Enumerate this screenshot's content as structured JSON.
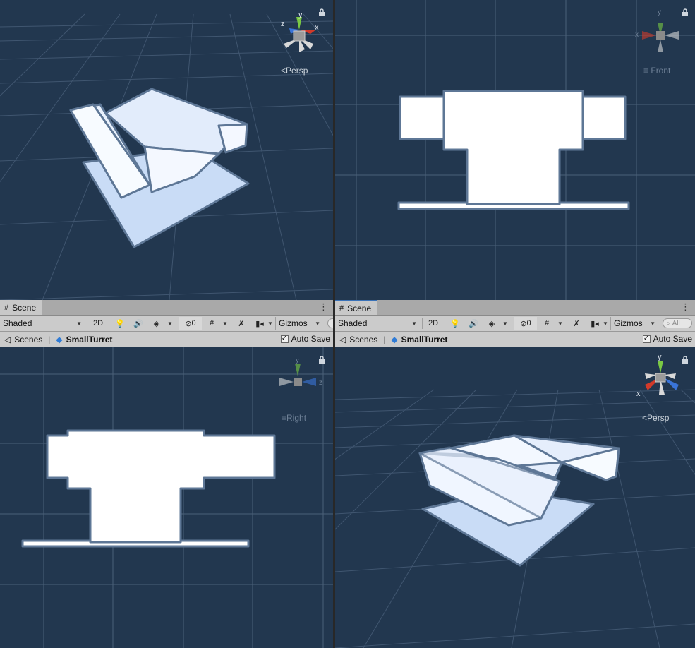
{
  "panes": {
    "top_left": {
      "projection_label": "Persp",
      "projection_icon": "perspective-icon",
      "gizmo": {
        "x": "x",
        "y": "y",
        "z": "z"
      }
    },
    "top_right": {
      "projection_label": "Front",
      "projection_icon": "ortho-lines-icon",
      "gizmo": {
        "y": "y",
        "x": "x"
      }
    },
    "bottom_left": {
      "tab_label": "Scene",
      "shading": "Shaded",
      "button_2d": "2D",
      "hidden_count": "0",
      "gizmos_label": "Gizmos",
      "breadcrumb_root": "Scenes",
      "breadcrumb_object": "SmallTurret",
      "auto_save_label": "Auto Save",
      "auto_save_checked": true,
      "projection_label": "Right",
      "gizmo": {
        "y": "y",
        "z": "z"
      }
    },
    "bottom_right": {
      "tab_label": "Scene",
      "shading": "Shaded",
      "button_2d": "2D",
      "hidden_count": "0",
      "gizmos_label": "Gizmos",
      "search_placeholder": "All",
      "breadcrumb_root": "Scenes",
      "breadcrumb_object": "SmallTurret",
      "auto_save_label": "Auto Save",
      "auto_save_checked": true,
      "projection_label": "Persp",
      "gizmo": {
        "y": "y",
        "x": "x"
      }
    }
  },
  "colors": {
    "viewport_bg": "#22374f",
    "grid_line": "#4b6078",
    "header_bg": "#cbcbcb",
    "tab_active_border": "#3a72b8",
    "axis_x": "#d23a2a",
    "axis_y": "#7ac943",
    "axis_z": "#3a74d8",
    "model_fill": "#ffffff",
    "model_outline": "#5e7796"
  }
}
